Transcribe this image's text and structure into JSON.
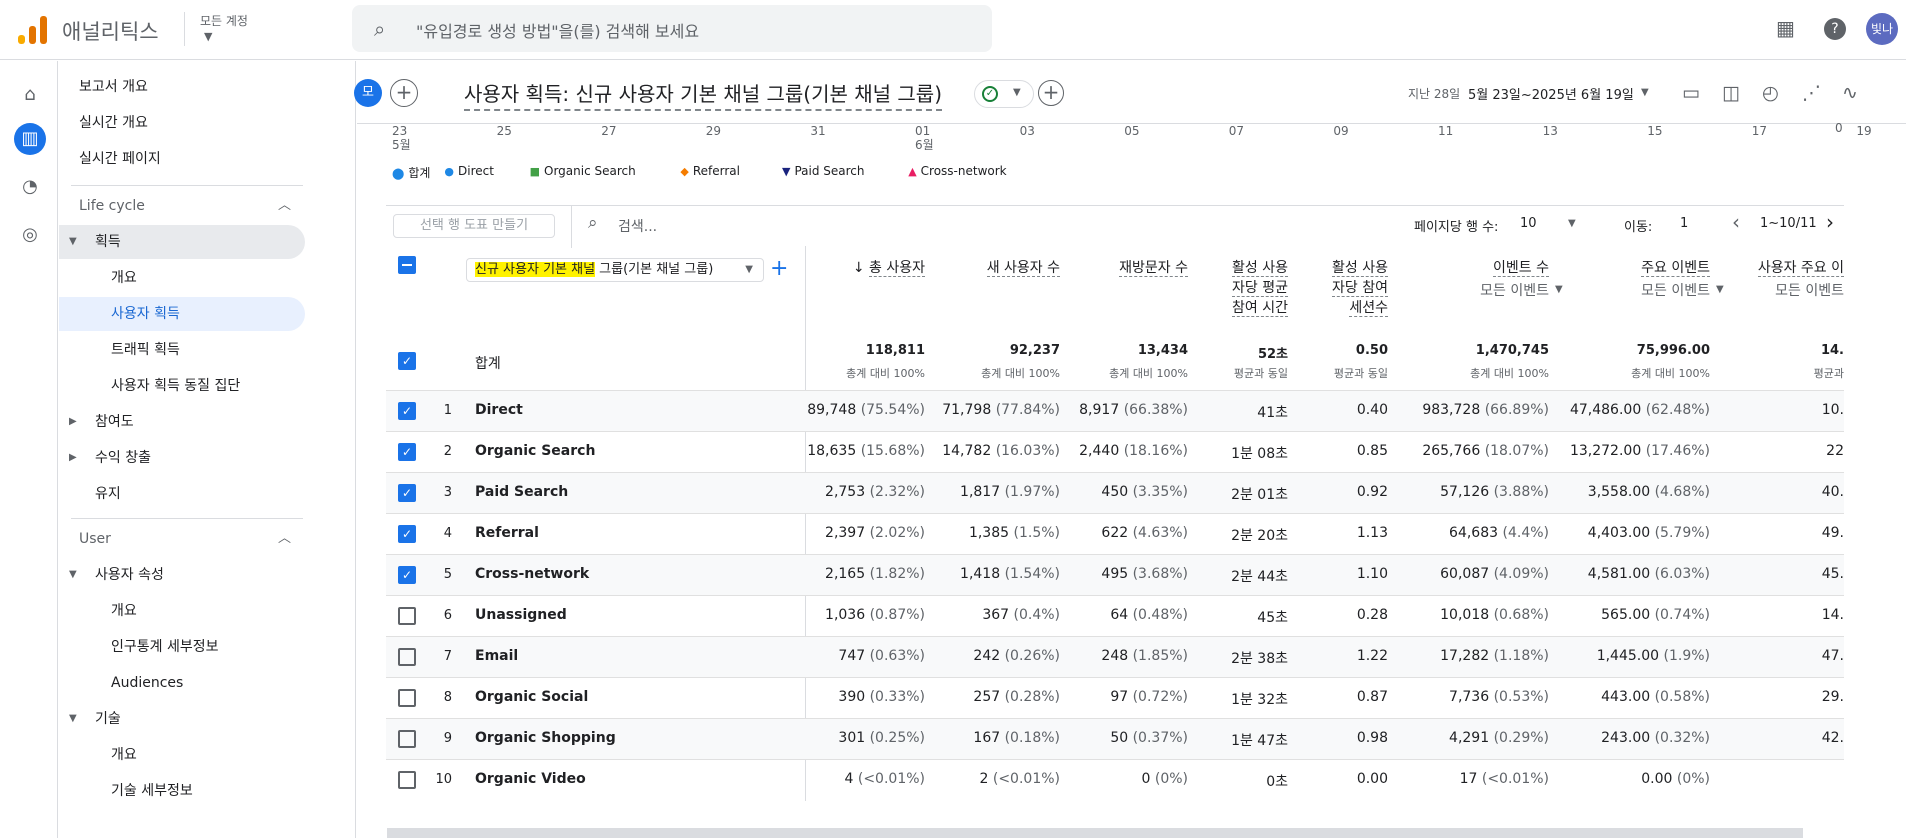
{
  "app": {
    "brand": "애널리틱스",
    "account": "모든 계정",
    "search_placeholder": "\"유입경로 생성 방법\"을(를) 검색해 보세요",
    "avatar": "빛나"
  },
  "sidebar": {
    "items": [
      {
        "label": "보고서 개요",
        "type": "top"
      },
      {
        "label": "실시간 개요",
        "type": "top"
      },
      {
        "label": "실시간 페이지",
        "type": "top"
      },
      {
        "label": "Life cycle",
        "type": "section"
      },
      {
        "label": "획득",
        "type": "group-open"
      },
      {
        "label": "개요",
        "type": "sub"
      },
      {
        "label": "사용자 획득",
        "type": "sub-selected"
      },
      {
        "label": "트래픽 획득",
        "type": "sub"
      },
      {
        "label": "사용자 획득 동질 집단",
        "type": "sub"
      },
      {
        "label": "참여도",
        "type": "group"
      },
      {
        "label": "수익 창출",
        "type": "group"
      },
      {
        "label": "유지",
        "type": "plain"
      },
      {
        "label": "User",
        "type": "section"
      },
      {
        "label": "사용자 속성",
        "type": "group-open"
      },
      {
        "label": "개요",
        "type": "sub"
      },
      {
        "label": "인구통계 세부정보",
        "type": "sub"
      },
      {
        "label": "Audiences",
        "type": "sub"
      },
      {
        "label": "기술",
        "type": "group-open"
      },
      {
        "label": "개요",
        "type": "sub"
      },
      {
        "label": "기술 세부정보",
        "type": "sub"
      }
    ]
  },
  "header": {
    "chip": "모",
    "title": "사용자 획득: 신규 사용자 기본 채널 그룹(기본 채널 그룹)",
    "date_label": "지난 28일",
    "date_value": "5월 23일~2025년 6월 19일"
  },
  "chart_data": {
    "type": "line",
    "x_ticks": [
      "23",
      "25",
      "27",
      "29",
      "31",
      "01",
      "03",
      "05",
      "07",
      "09",
      "11",
      "13",
      "15",
      "17",
      "19"
    ],
    "x_month_labels": {
      "0": "5월",
      "5": "6월"
    },
    "y_tick_visible": "0",
    "legend": [
      {
        "name": "합계",
        "color": "#1e88e5",
        "marker": "pin"
      },
      {
        "name": "Direct",
        "color": "#1e88e5",
        "marker": "circle"
      },
      {
        "name": "Organic Search",
        "color": "#43a047",
        "marker": "square"
      },
      {
        "name": "Referral",
        "color": "#f57c00",
        "marker": "diamond"
      },
      {
        "name": "Paid Search",
        "color": "#1a237e",
        "marker": "triangle-down"
      },
      {
        "name": "Cross-network",
        "color": "#e91e63",
        "marker": "triangle-up"
      }
    ]
  },
  "toolbar": {
    "chart_button": "선택 행 도표 만들기",
    "search_placeholder": "검색...",
    "rows_label": "페이지당 행 수:",
    "rows_value": "10",
    "goto_label": "이동:",
    "goto_value": "1",
    "range": "1~10/11"
  },
  "table": {
    "dimension": {
      "highlight": "신규 사용자 기본 채널",
      "rest": " 그룹(기본 채널 그룹)"
    },
    "columns": [
      {
        "label": "총 사용자",
        "sub": "",
        "sorted": true
      },
      {
        "label": "새 사용자 수",
        "sub": ""
      },
      {
        "label": "재방문자 수",
        "sub": ""
      },
      {
        "label": "활성 사용\n자당 평균\n참여 시간",
        "sub": ""
      },
      {
        "label": "활성 사용\n자당 참여\n세션수",
        "sub": ""
      },
      {
        "label": "이벤트 수",
        "sub": "모든 이벤트"
      },
      {
        "label": "주요 이벤트",
        "sub": "모든 이벤트"
      },
      {
        "label": "사용자 주요 이",
        "sub": "모든 이벤트"
      }
    ],
    "totals_label": "합계",
    "totals": [
      {
        "v": "118,811",
        "s": "총계 대비 100%"
      },
      {
        "v": "92,237",
        "s": "총계 대비 100%"
      },
      {
        "v": "13,434",
        "s": "총계 대비 100%"
      },
      {
        "v": "52초",
        "s": "평균과 동일"
      },
      {
        "v": "0.50",
        "s": "평균과 동일"
      },
      {
        "v": "1,470,745",
        "s": "총계 대비 100%"
      },
      {
        "v": "75,996.00",
        "s": "총계 대비 100%"
      },
      {
        "v": "14.",
        "s": "평균과"
      }
    ],
    "rows": [
      {
        "n": "1",
        "label": "Direct",
        "checked": true,
        "cells": [
          [
            "89,748",
            "(75.54%)"
          ],
          [
            "71,798",
            "(77.84%)"
          ],
          [
            "8,917",
            "(66.38%)"
          ],
          [
            "41초",
            ""
          ],
          [
            "0.40",
            ""
          ],
          [
            "983,728",
            "(66.89%)"
          ],
          [
            "47,486.00",
            "(62.48%)"
          ],
          [
            "10.",
            ""
          ]
        ]
      },
      {
        "n": "2",
        "label": "Organic Search",
        "checked": true,
        "cells": [
          [
            "18,635",
            "(15.68%)"
          ],
          [
            "14,782",
            "(16.03%)"
          ],
          [
            "2,440",
            "(18.16%)"
          ],
          [
            "1분 08초",
            ""
          ],
          [
            "0.85",
            ""
          ],
          [
            "265,766",
            "(18.07%)"
          ],
          [
            "13,272.00",
            "(17.46%)"
          ],
          [
            "22",
            ""
          ]
        ]
      },
      {
        "n": "3",
        "label": "Paid Search",
        "checked": true,
        "cells": [
          [
            "2,753",
            "(2.32%)"
          ],
          [
            "1,817",
            "(1.97%)"
          ],
          [
            "450",
            "(3.35%)"
          ],
          [
            "2분 01초",
            ""
          ],
          [
            "0.92",
            ""
          ],
          [
            "57,126",
            "(3.88%)"
          ],
          [
            "3,558.00",
            "(4.68%)"
          ],
          [
            "40.",
            ""
          ]
        ]
      },
      {
        "n": "4",
        "label": "Referral",
        "checked": true,
        "cells": [
          [
            "2,397",
            "(2.02%)"
          ],
          [
            "1,385",
            "(1.5%)"
          ],
          [
            "622",
            "(4.63%)"
          ],
          [
            "2분 20초",
            ""
          ],
          [
            "1.13",
            ""
          ],
          [
            "64,683",
            "(4.4%)"
          ],
          [
            "4,403.00",
            "(5.79%)"
          ],
          [
            "49.",
            ""
          ]
        ]
      },
      {
        "n": "5",
        "label": "Cross-network",
        "checked": true,
        "cells": [
          [
            "2,165",
            "(1.82%)"
          ],
          [
            "1,418",
            "(1.54%)"
          ],
          [
            "495",
            "(3.68%)"
          ],
          [
            "2분 44초",
            ""
          ],
          [
            "1.10",
            ""
          ],
          [
            "60,087",
            "(4.09%)"
          ],
          [
            "4,581.00",
            "(6.03%)"
          ],
          [
            "45.",
            ""
          ]
        ]
      },
      {
        "n": "6",
        "label": "Unassigned",
        "checked": false,
        "cells": [
          [
            "1,036",
            "(0.87%)"
          ],
          [
            "367",
            "(0.4%)"
          ],
          [
            "64",
            "(0.48%)"
          ],
          [
            "45초",
            ""
          ],
          [
            "0.28",
            ""
          ],
          [
            "10,018",
            "(0.68%)"
          ],
          [
            "565.00",
            "(0.74%)"
          ],
          [
            "14.",
            ""
          ]
        ]
      },
      {
        "n": "7",
        "label": "Email",
        "checked": false,
        "cells": [
          [
            "747",
            "(0.63%)"
          ],
          [
            "242",
            "(0.26%)"
          ],
          [
            "248",
            "(1.85%)"
          ],
          [
            "2분 38초",
            ""
          ],
          [
            "1.22",
            ""
          ],
          [
            "17,282",
            "(1.18%)"
          ],
          [
            "1,445.00",
            "(1.9%)"
          ],
          [
            "47.",
            ""
          ]
        ]
      },
      {
        "n": "8",
        "label": "Organic Social",
        "checked": false,
        "cells": [
          [
            "390",
            "(0.33%)"
          ],
          [
            "257",
            "(0.28%)"
          ],
          [
            "97",
            "(0.72%)"
          ],
          [
            "1분 32초",
            ""
          ],
          [
            "0.87",
            ""
          ],
          [
            "7,736",
            "(0.53%)"
          ],
          [
            "443.00",
            "(0.58%)"
          ],
          [
            "29.",
            ""
          ]
        ]
      },
      {
        "n": "9",
        "label": "Organic Shopping",
        "checked": false,
        "cells": [
          [
            "301",
            "(0.25%)"
          ],
          [
            "167",
            "(0.18%)"
          ],
          [
            "50",
            "(0.37%)"
          ],
          [
            "1분 47초",
            ""
          ],
          [
            "0.98",
            ""
          ],
          [
            "4,291",
            "(0.29%)"
          ],
          [
            "243.00",
            "(0.32%)"
          ],
          [
            "42.",
            ""
          ]
        ]
      },
      {
        "n": "10",
        "label": "Organic Video",
        "checked": false,
        "cells": [
          [
            "4",
            "(<0.01%)"
          ],
          [
            "2",
            "(<0.01%)"
          ],
          [
            "0",
            "(0%)"
          ],
          [
            "0초",
            ""
          ],
          [
            "0.00",
            ""
          ],
          [
            "17",
            "(<0.01%)"
          ],
          [
            "0.00",
            "(0%)"
          ],
          [
            "",
            ""
          ]
        ]
      }
    ]
  }
}
